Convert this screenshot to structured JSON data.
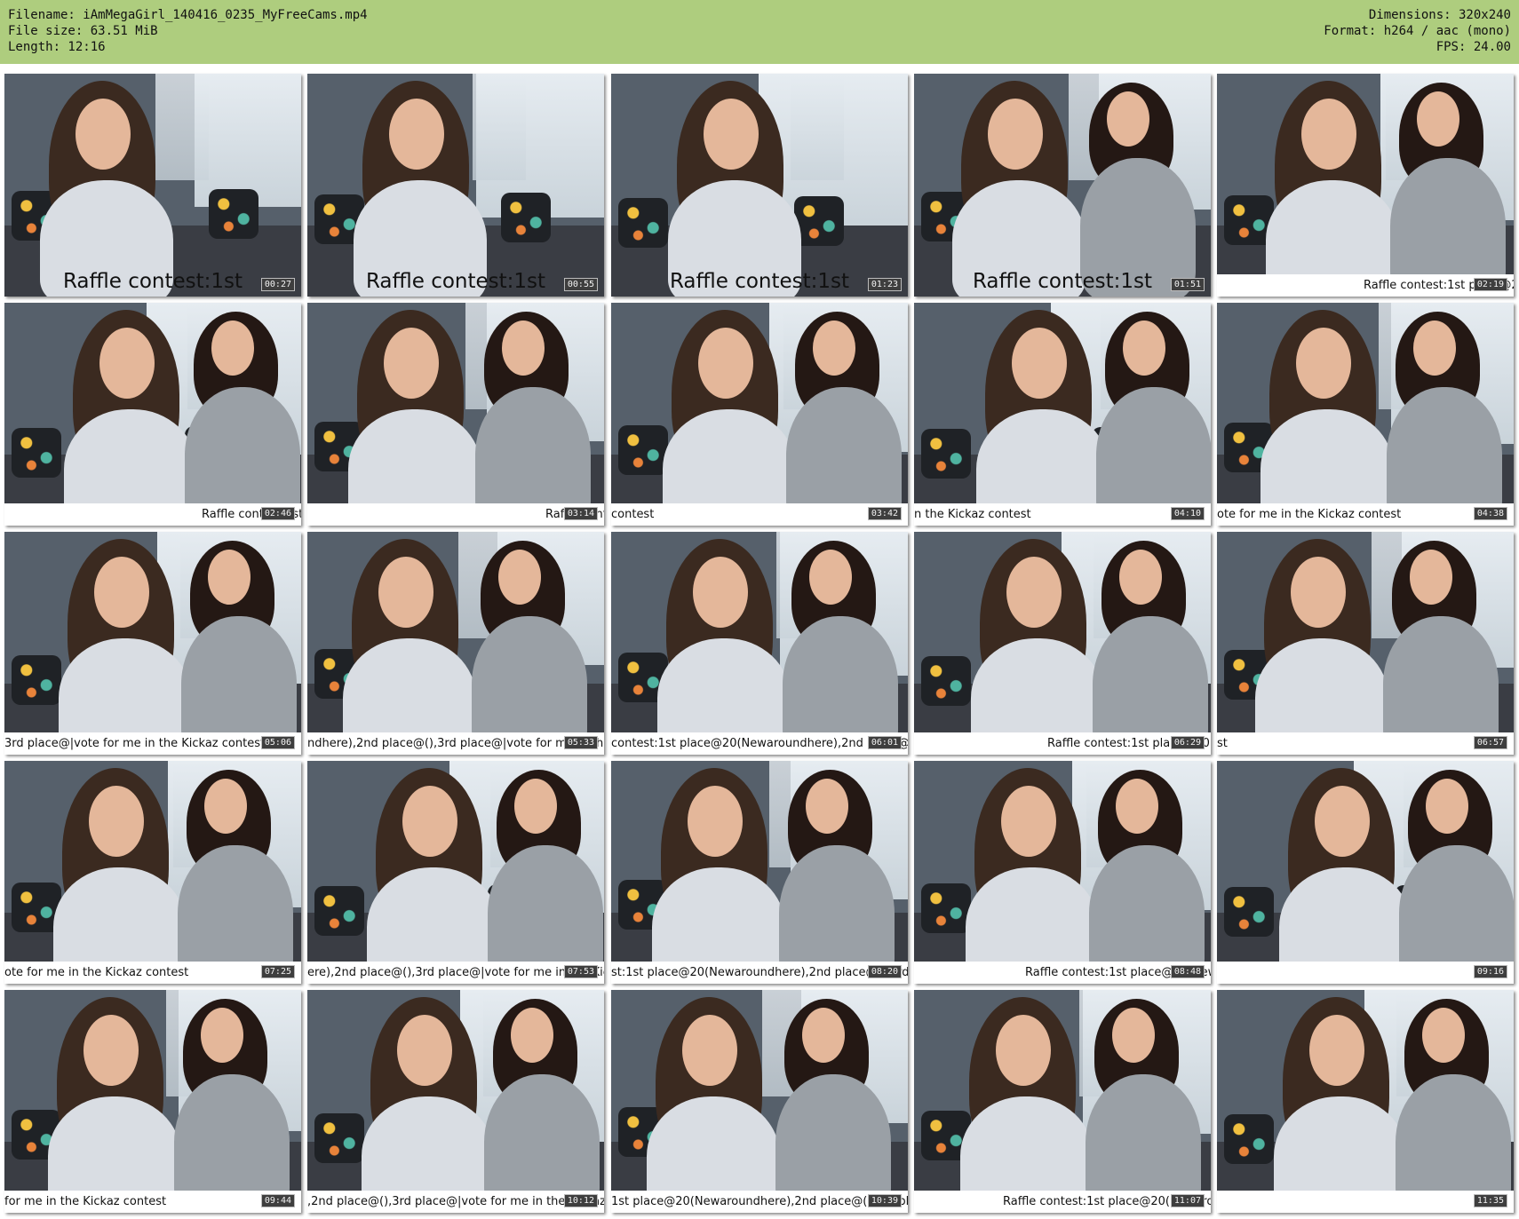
{
  "header": {
    "left": [
      "Filename: iAmMegaGirl_140416_0235_MyFreeCams.mp4",
      "File size: 63.51 MiB",
      "Length: 12:16"
    ],
    "right": [
      "Dimensions: 320x240",
      "Format: h264 / aac (mono)",
      "FPS: 24.00"
    ]
  },
  "thumbs": [
    {
      "time": "00:27",
      "caption": "Raffle contest:1st",
      "big": true,
      "captionAlign": "center"
    },
    {
      "time": "00:55",
      "caption": "Raffle contest:1st",
      "big": true,
      "captionAlign": "center"
    },
    {
      "time": "01:23",
      "caption": "Raffle contest:1st",
      "big": true,
      "captionAlign": "center"
    },
    {
      "time": "01:51",
      "caption": "Raffle contest:1st",
      "big": true,
      "captionAlign": "center"
    },
    {
      "time": "02:19",
      "caption": "Raffle contest:1st place@20(",
      "big": false,
      "captionOffset": 165
    },
    {
      "time": "02:46",
      "caption": "Raffle contest:1st",
      "big": false,
      "captionOffset": 222
    },
    {
      "time": "03:14",
      "caption": "Raffle contest",
      "big": false,
      "captionOffset": 268
    },
    {
      "time": "03:42",
      "caption": "contest",
      "big": false,
      "captionOffset": 0
    },
    {
      "time": "04:10",
      "caption": "n the Kickaz contest",
      "big": false,
      "captionOffset": 0
    },
    {
      "time": "04:38",
      "caption": "ote for me in the Kickaz contest",
      "big": false,
      "captionOffset": 0
    },
    {
      "time": "05:06",
      "caption": "3rd place@|vote for me in the Kickaz contest",
      "big": false,
      "captionOffset": 0
    },
    {
      "time": "05:33",
      "caption": "ndhere),2nd place@(),3rd place@|vote for me in the Kickaz contest",
      "big": false,
      "captionOffset": 0
    },
    {
      "time": "06:01",
      "caption": "contest:1st place@20(Newaroundhere),2nd place@(),3",
      "big": false,
      "captionOffset": 0
    },
    {
      "time": "06:29",
      "caption": "Raffle contest:1st place@20(Newaroundhere)",
      "big": false,
      "captionOffset": 150
    },
    {
      "time": "06:57",
      "caption": "st",
      "big": false,
      "captionOffset": 0
    },
    {
      "time": "07:25",
      "caption": "ote for me in the Kickaz contest",
      "big": false,
      "captionOffset": 0
    },
    {
      "time": "07:53",
      "caption": "ere),2nd place@(),3rd place@|vote for me in the Kickaz contest",
      "big": false,
      "captionOffset": 0
    },
    {
      "time": "08:20",
      "caption": "st:1st place@20(Newaroundhere),2nd place@(),3rd",
      "big": false,
      "captionOffset": 0
    },
    {
      "time": "08:48",
      "caption": "Raffle contest:1st place@20(Newaroundhere),2nd place@(),3rd",
      "big": false,
      "captionOffset": 125
    },
    {
      "time": "09:16",
      "caption": "",
      "big": false,
      "captionOffset": 0
    },
    {
      "time": "09:44",
      "caption": "for me in the Kickaz contest",
      "big": false,
      "captionOffset": 0
    },
    {
      "time": "10:12",
      "caption": ",2nd place@(),3rd place@|vote for me in the Kickaz contest",
      "big": false,
      "captionOffset": 0
    },
    {
      "time": "10:39",
      "caption": "1st place@20(Newaroundhere),2nd place@(),3rd place",
      "big": false,
      "captionOffset": 0
    },
    {
      "time": "11:07",
      "caption": "Raffle contest:1st place@20(Newaroundhere)",
      "big": false,
      "captionOffset": 100
    },
    {
      "time": "11:35",
      "caption": "",
      "big": false,
      "captionOffset": 0
    }
  ],
  "colors": {
    "header_bg": "#aecd7e",
    "timestamp_bg": "#3e3e3e"
  }
}
